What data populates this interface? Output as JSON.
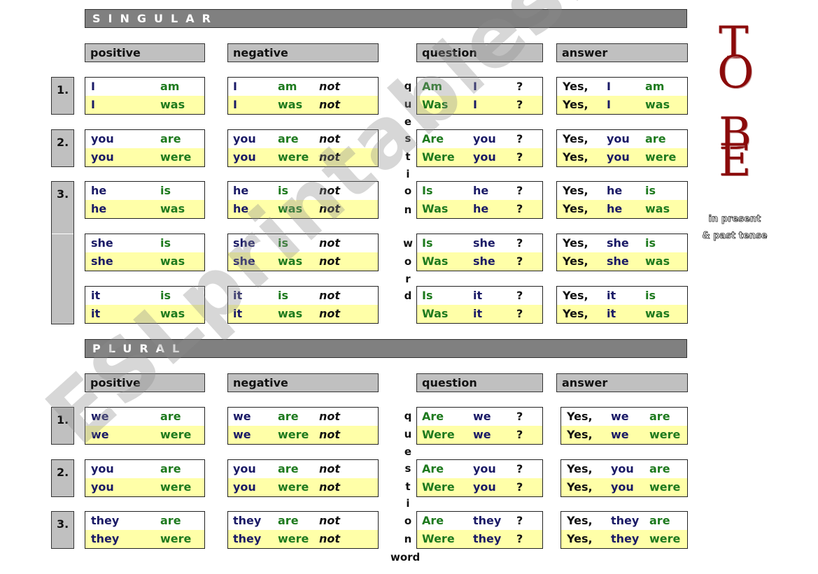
{
  "title": {
    "letters": [
      "T",
      "O",
      "B",
      "E"
    ],
    "subtitle_line1": "in present",
    "subtitle_line2": "& past tense"
  },
  "watermark": "ESLprintables.com",
  "colors": {
    "pronoun": "#1a1a66",
    "verb": "#1e7a1e",
    "row_highlight": "#ffffa8",
    "section_bar": "#808080",
    "subheader": "#c0c0c0",
    "title": "#8b0a0a"
  },
  "headers": {
    "positive": "positive",
    "negative": "negative",
    "question": "question",
    "answer": "answer"
  },
  "question_word_letters": [
    "q",
    "u",
    "e",
    "s",
    "t",
    "i",
    "o",
    "n",
    "w",
    "o",
    "r",
    "d"
  ],
  "plural_question_letters": [
    "q",
    "u",
    "e",
    "s",
    "t",
    "i",
    "o",
    "n"
  ],
  "plural_word_label": "word",
  "singular": {
    "label": "SINGULAR",
    "numbers": [
      "1.",
      "2.",
      "3."
    ],
    "groups": [
      {
        "pos": [
          [
            "I",
            "am"
          ],
          [
            "I",
            "was"
          ]
        ],
        "neg": [
          [
            "I",
            "am",
            "not"
          ],
          [
            "I",
            "was",
            "not"
          ]
        ],
        "q": [
          [
            "Am",
            "I",
            "?"
          ],
          [
            "Was",
            "I",
            "?"
          ]
        ],
        "a": [
          [
            "Yes,",
            "I",
            "am"
          ],
          [
            "Yes,",
            "I",
            "was"
          ]
        ]
      },
      {
        "pos": [
          [
            "you",
            "are"
          ],
          [
            "you",
            "were"
          ]
        ],
        "neg": [
          [
            "you",
            "are",
            "not"
          ],
          [
            "you",
            "were",
            "not"
          ]
        ],
        "q": [
          [
            "Are",
            "you",
            "?"
          ],
          [
            "Were",
            "you",
            "?"
          ]
        ],
        "a": [
          [
            "Yes,",
            "you",
            "are"
          ],
          [
            "Yes,",
            "you",
            "were"
          ]
        ]
      },
      {
        "pos": [
          [
            "he",
            "is"
          ],
          [
            "he",
            "was"
          ]
        ],
        "neg": [
          [
            "he",
            "is",
            "not"
          ],
          [
            "he",
            "was",
            "not"
          ]
        ],
        "q": [
          [
            "Is",
            "he",
            "?"
          ],
          [
            "Was",
            "he",
            "?"
          ]
        ],
        "a": [
          [
            "Yes,",
            "he",
            "is"
          ],
          [
            "Yes,",
            "he",
            "was"
          ]
        ]
      },
      {
        "pos": [
          [
            "she",
            "is"
          ],
          [
            "she",
            "was"
          ]
        ],
        "neg": [
          [
            "she",
            "is",
            "not"
          ],
          [
            "she",
            "was",
            "not"
          ]
        ],
        "q": [
          [
            "Is",
            "she",
            "?"
          ],
          [
            "Was",
            "she",
            "?"
          ]
        ],
        "a": [
          [
            "Yes,",
            "she",
            "is"
          ],
          [
            "Yes,",
            "she",
            "was"
          ]
        ]
      },
      {
        "pos": [
          [
            "it",
            "is"
          ],
          [
            "it",
            "was"
          ]
        ],
        "neg": [
          [
            "it",
            "is",
            "not"
          ],
          [
            "it",
            "was",
            "not"
          ]
        ],
        "q": [
          [
            "Is",
            "it",
            "?"
          ],
          [
            "Was",
            "it",
            "?"
          ]
        ],
        "a": [
          [
            "Yes,",
            "it",
            "is"
          ],
          [
            "Yes,",
            "it",
            "was"
          ]
        ]
      }
    ]
  },
  "plural": {
    "label": "PLURAL",
    "numbers": [
      "1.",
      "2.",
      "3."
    ],
    "groups": [
      {
        "pos": [
          [
            "we",
            "are"
          ],
          [
            "we",
            "were"
          ]
        ],
        "neg": [
          [
            "we",
            "are",
            "not"
          ],
          [
            "we",
            "were",
            "not"
          ]
        ],
        "q": [
          [
            "Are",
            "we",
            "?"
          ],
          [
            "Were",
            "we",
            "?"
          ]
        ],
        "a": [
          [
            "Yes,",
            "we",
            "are"
          ],
          [
            "Yes,",
            "we",
            "were"
          ]
        ]
      },
      {
        "pos": [
          [
            "you",
            "are"
          ],
          [
            "you",
            "were"
          ]
        ],
        "neg": [
          [
            "you",
            "are",
            "not"
          ],
          [
            "you",
            "were",
            "not"
          ]
        ],
        "q": [
          [
            "Are",
            "you",
            "?"
          ],
          [
            "Were",
            "you",
            "?"
          ]
        ],
        "a": [
          [
            "Yes,",
            "you",
            "are"
          ],
          [
            "Yes,",
            "you",
            "were"
          ]
        ]
      },
      {
        "pos": [
          [
            "they",
            "are"
          ],
          [
            "they",
            "were"
          ]
        ],
        "neg": [
          [
            "they",
            "are",
            "not"
          ],
          [
            "they",
            "were",
            "not"
          ]
        ],
        "q": [
          [
            "Are",
            "they",
            "?"
          ],
          [
            "Were",
            "they",
            "?"
          ]
        ],
        "a": [
          [
            "Yes,",
            "they",
            "are"
          ],
          [
            "Yes,",
            "they",
            "were"
          ]
        ]
      }
    ]
  }
}
